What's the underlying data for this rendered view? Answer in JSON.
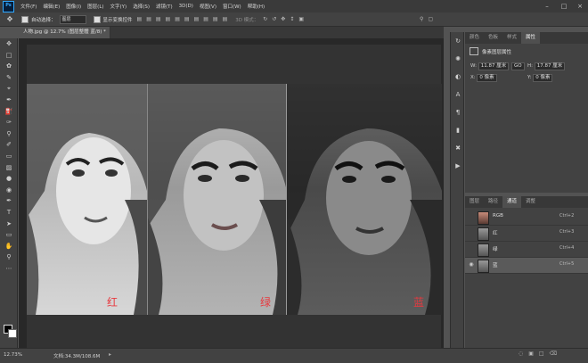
{
  "app": {
    "logo": "Ps",
    "menu": [
      "文件(F)",
      "编辑(E)",
      "图像(I)",
      "图层(L)",
      "文字(Y)",
      "选择(S)",
      "滤镜(T)",
      "3D(D)",
      "视图(V)",
      "窗口(W)",
      "帮助(H)"
    ]
  },
  "options": {
    "auto_select_label": "自动选择：",
    "auto_select_value": "图层",
    "show_transform_label": "显示变换控件",
    "mode_3d_label": "3D 模式："
  },
  "document": {
    "tab_title": "人物.jpg @ 12.7% (图层整體 蓝/8) *",
    "labels": {
      "red": "红",
      "green": "绿",
      "blue": "蓝"
    }
  },
  "status": {
    "zoom": "12.73%",
    "doc_info": "文档:34.3M/108.6M"
  },
  "properties_panel": {
    "tabs": [
      "颜色",
      "色板",
      "样式",
      "属性"
    ],
    "active_tab": "属性",
    "title": "像素图层属性",
    "w_label": "W:",
    "w_value": "11.87 厘米",
    "link_label": "GO",
    "h_label": "H:",
    "h_value": "17.87 厘米",
    "x_label": "X:",
    "x_value": "0 像素",
    "y_label": "Y:",
    "y_value": "0 像素"
  },
  "channels_panel": {
    "tabs": [
      "图层",
      "路径",
      "通道",
      "调整"
    ],
    "active_tab": "通道",
    "rows": [
      {
        "name": "RGB",
        "shortcut": "Ctrl+2"
      },
      {
        "name": "红",
        "shortcut": "Ctrl+3"
      },
      {
        "name": "绿",
        "shortcut": "Ctrl+4"
      },
      {
        "name": "蓝",
        "shortcut": "Ctrl+5"
      }
    ],
    "selected_row": "蓝"
  },
  "icons": {
    "tools": [
      "move-icon",
      "marquee-icon",
      "lasso-icon",
      "quick-select-icon",
      "crop-icon",
      "eyedropper-icon",
      "healing-brush-icon",
      "brush-icon",
      "clone-stamp-icon",
      "history-brush-icon",
      "eraser-icon",
      "gradient-icon",
      "blur-icon",
      "dodge-icon",
      "pen-icon",
      "type-icon",
      "path-select-icon",
      "shape-icon",
      "hand-icon",
      "zoom-icon",
      "more-tools-icon"
    ],
    "strip": [
      "history-icon",
      "brush-settings-icon",
      "adjust-icon",
      "character-icon",
      "paragraph-icon",
      "glyphs-icon",
      "tool-presets-icon",
      "actions-icon"
    ]
  }
}
